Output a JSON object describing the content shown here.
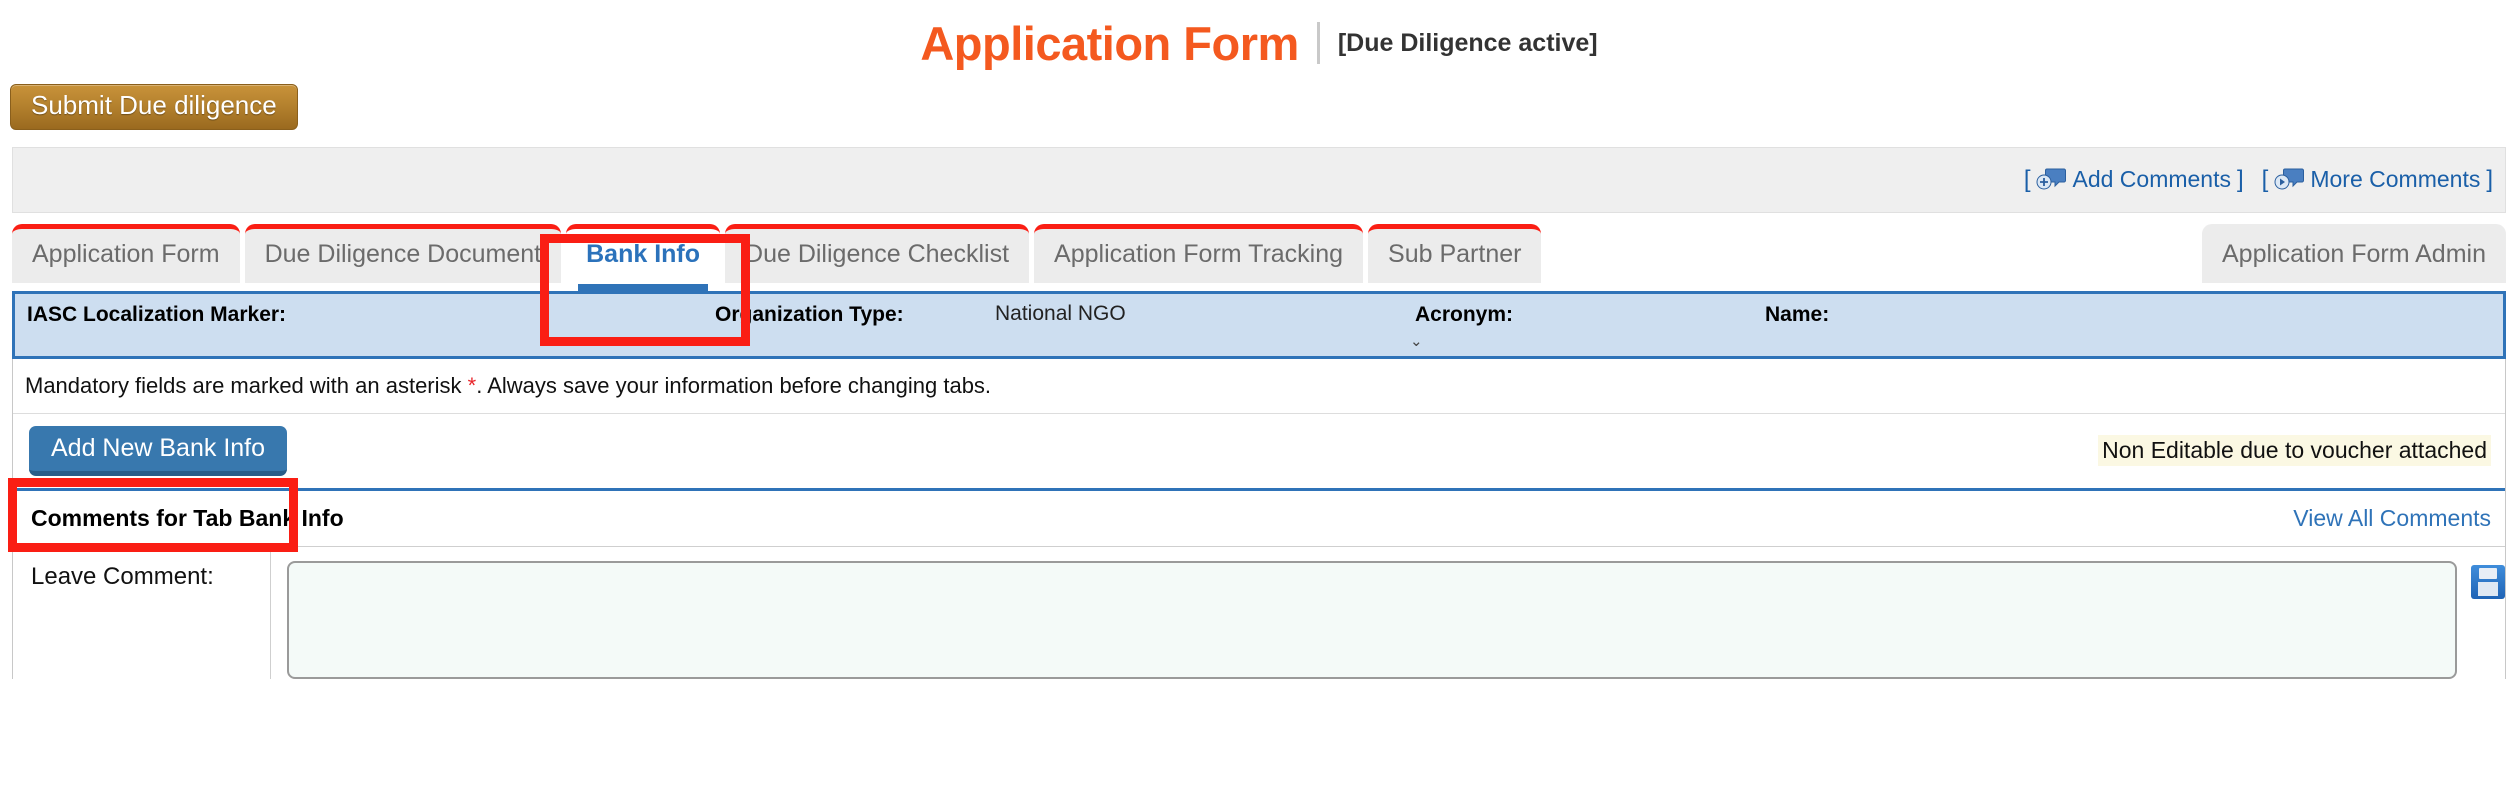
{
  "header": {
    "title": "Application Form",
    "status": "[Due Diligence active]",
    "title_color": "#f4591f"
  },
  "actions": {
    "submit_label": "Submit Due diligence"
  },
  "comments_bar": {
    "open_bracket": "[",
    "close_bracket": "]",
    "add_comments_label": "Add Comments",
    "more_comments_label": "More Comments",
    "add_icon": "comment-add-icon",
    "more_icon": "comment-more-icon",
    "link_color": "#1a5fa8"
  },
  "tabs": {
    "items": [
      {
        "label": "Application Form",
        "active": false
      },
      {
        "label": "Due Diligence Document",
        "active": false
      },
      {
        "label": "Bank Info",
        "active": true
      },
      {
        "label": "Due Diligence Checklist",
        "active": false
      },
      {
        "label": "Application Form Tracking",
        "active": false
      },
      {
        "label": "Sub Partner",
        "active": false
      }
    ],
    "admin_tab": "Application Form Admin",
    "active_tab": "Bank Info",
    "highlight_color": "#fa1e14",
    "active_color": "#2b72bb"
  },
  "info_strip": {
    "iasc_label": "IASC Localization Marker:",
    "iasc_value": "",
    "org_type_label": "Organization Type:",
    "org_type_value": "National NGO",
    "acronym_label": "Acronym:",
    "acronym_value": "",
    "name_label": "Name:",
    "name_value": "",
    "chevron": "⌄",
    "bg_color": "#cddef0",
    "border_color": "#2f73b8"
  },
  "notice": {
    "mandatory_pre": "Mandatory fields are marked with an asterisk ",
    "asterisk": "*",
    "mandatory_post": ". Always save your information before changing tabs.",
    "asterisk_color": "#e8252b"
  },
  "bank_info": {
    "add_button_label": "Add New Bank Info",
    "non_editable_message": "Non Editable due to voucher attached",
    "add_button_color": "#3878ae"
  },
  "comments_section": {
    "title": "Comments for Tab Bank Info",
    "view_all_label": "View All Comments",
    "leave_comment_label": "Leave Comment:",
    "comment_value": "",
    "comment_placeholder": "",
    "save_icon": "save-floppy-icon"
  },
  "annotations": {
    "tab_highlight": "Bank Info",
    "button_highlight": "Add New Bank Info",
    "color": "#fa1e14"
  }
}
